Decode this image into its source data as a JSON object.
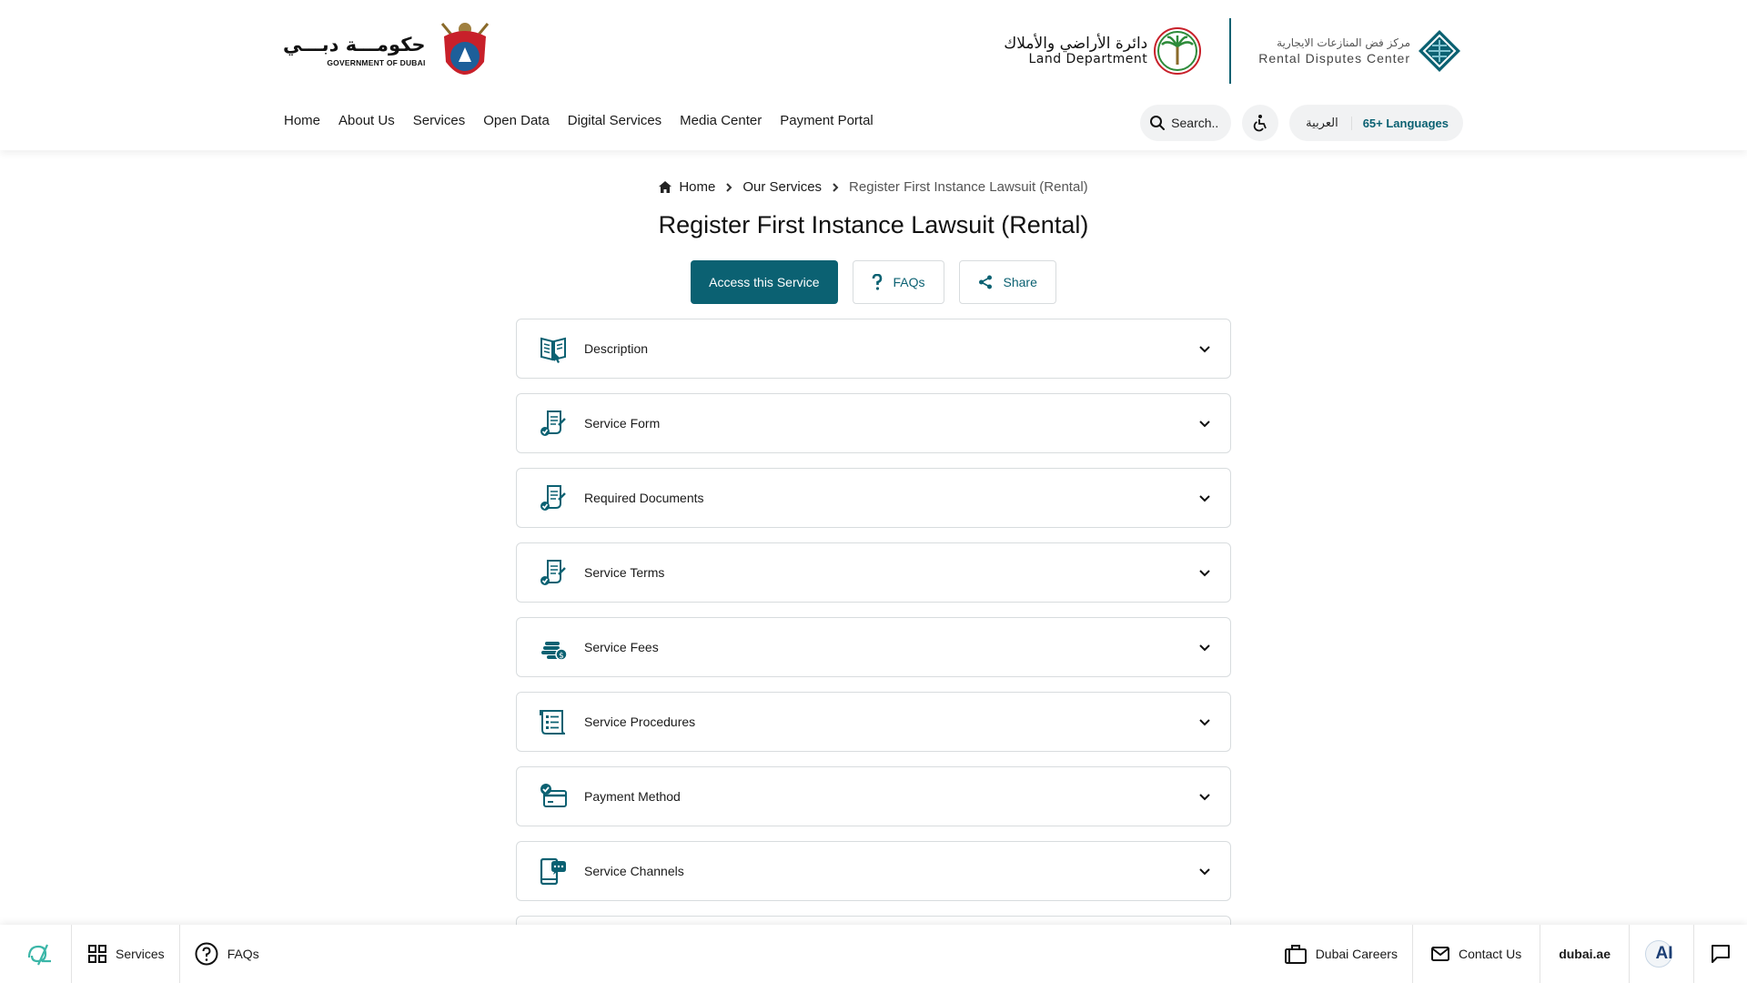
{
  "header": {
    "gov_logo": {
      "arabic": "حكومـــة دبـــي",
      "english": "GOVERNMENT OF DUBAI",
      "icon": "dubai-emblem-icon"
    },
    "land_department": {
      "arabic": "دائرة الأراضي والأملاك",
      "english": "Land Department",
      "icon": "palm-logo-icon"
    },
    "rental_disputes": {
      "arabic": "مركز فض المنازعات الايجارية",
      "english": "Rental Disputes Center",
      "icon": "rdc-logo-icon"
    },
    "nav": [
      {
        "label": "Home"
      },
      {
        "label": "About Us"
      },
      {
        "label": "Services"
      },
      {
        "label": "Open Data"
      },
      {
        "label": "Digital Services"
      },
      {
        "label": "Media Center"
      },
      {
        "label": "Payment Portal"
      }
    ],
    "search_placeholder": "Search..",
    "lang_arabic": "العربية",
    "lang_more": "65+ Languages"
  },
  "breadcrumb": {
    "home": "Home",
    "services": "Our Services",
    "current": "Register First Instance Lawsuit (Rental)"
  },
  "page_title": "Register First Instance Lawsuit (Rental)",
  "actions": {
    "access": "Access this Service",
    "faqs": "FAQs",
    "share": "Share"
  },
  "accordion": [
    {
      "label": "Description",
      "icon": "book-icon"
    },
    {
      "label": "Service Form",
      "icon": "document-check-icon"
    },
    {
      "label": "Required Documents",
      "icon": "document-check-icon"
    },
    {
      "label": "Service Terms",
      "icon": "document-check-icon"
    },
    {
      "label": "Service Fees",
      "icon": "coins-icon"
    },
    {
      "label": "Service Procedures",
      "icon": "procedures-icon"
    },
    {
      "label": "Payment Method",
      "icon": "card-check-icon"
    },
    {
      "label": "Service Channels",
      "icon": "phone-chat-icon"
    }
  ],
  "bottom_bar": {
    "services": "Services",
    "faqs": "FAQs",
    "careers": "Dubai Careers",
    "contact": "Contact Us",
    "dubai_ae": "dubai.ae",
    "ai": "AI"
  },
  "colors": {
    "accent": "#0b6172",
    "border": "#d8dcde",
    "pill_bg": "#f1f2f3"
  }
}
